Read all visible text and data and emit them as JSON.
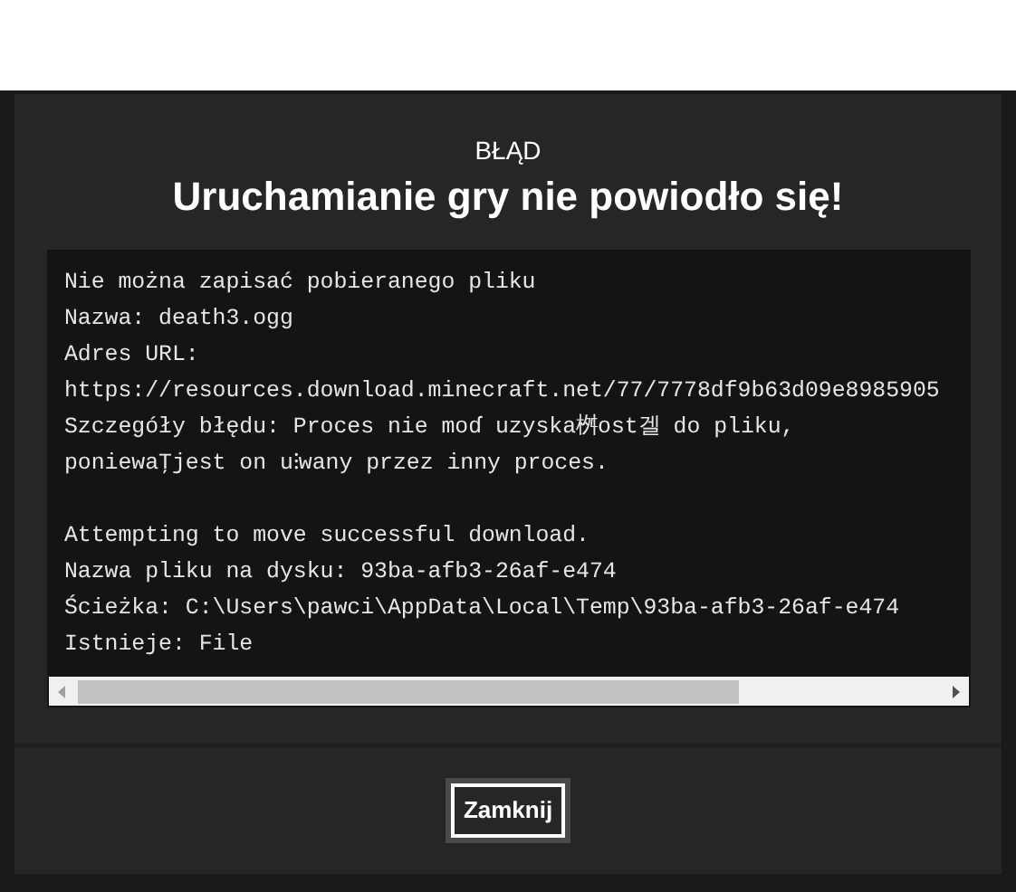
{
  "dialog": {
    "kicker": "BŁĄD",
    "title": "Uruchamianie gry nie powiodło się!",
    "log_blocks": [
      [
        "Nie można zapisać pobieranego pliku",
        "Nazwa: death3.ogg",
        "Adres URL:",
        "https://resources.download.minecraft.net/77/7778df9b63d09e8985905",
        "Szczegóły błędu: Proces nie moɗ uzyska桝ost겔 do pliku,",
        "poniewaŢjest on u⁝wany przez inny proces."
      ],
      [
        "Attempting to move successful download.",
        "Nazwa pliku na dysku: 93ba-afb3-26af-e474",
        "Ścieżka: C:\\Users\\pawci\\AppData\\Local\\Temp\\93ba-afb3-26af-e474",
        "Istnieje: File"
      ]
    ],
    "buttons": [
      {
        "label": "Zamknij"
      }
    ]
  }
}
